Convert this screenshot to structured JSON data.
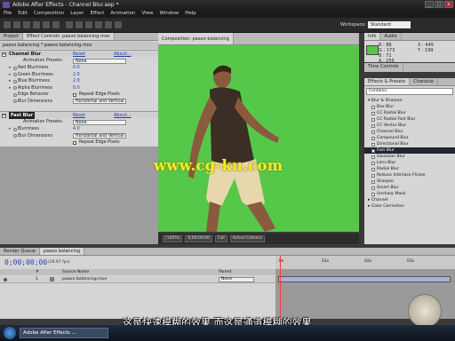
{
  "window": {
    "title": "Adobe After Effects - Channel Blur.aep *",
    "buttons": [
      "_",
      "□",
      "x"
    ]
  },
  "menu": [
    "File",
    "Edit",
    "Composition",
    "Layer",
    "Effect",
    "Animation",
    "View",
    "Window",
    "Help"
  ],
  "workspace": {
    "label": "Workspace:",
    "value": "Standard"
  },
  "left_panel": {
    "tabs": [
      "Project",
      "Effect Controls: paavo balancing.mov"
    ],
    "breadcrumb": "paavo balancing * paavo balancing.mov",
    "channel_blur": {
      "name": "Channel Blur",
      "reset": "Reset",
      "about": "About...",
      "presets_label": "Animation Presets:",
      "presets_value": "None",
      "rows": [
        {
          "label": "Red Blurriness",
          "value": "0.0"
        },
        {
          "label": "Green Blurriness",
          "value": "2.0"
        },
        {
          "label": "Blue Blurriness",
          "value": "2.0"
        },
        {
          "label": "Alpha Blurriness",
          "value": "0.0"
        }
      ],
      "edge_label": "Edge Behavior",
      "edge_value": "Repeat Edge Pixels",
      "dim_label": "Blur Dimensions",
      "dim_value": "Horizontal and Vertical"
    },
    "fast_blur": {
      "name": "Fast Blur",
      "reset": "Reset",
      "about": "About...",
      "presets_label": "Animation Presets:",
      "presets_value": "None",
      "blurriness_label": "Blurriness",
      "blurriness_value": "4.0",
      "dim_label": "Blur Dimensions",
      "dim_value": "Horizontal and Vertical",
      "repeat_label": "Repeat Edge Pixels"
    }
  },
  "comp": {
    "tab": "Composition: paavo balancing",
    "watermark": "www.cg-ku.com",
    "zoom": "(100%)",
    "time": "0;00;00;00",
    "quality": "Full",
    "camera": "Active Camera"
  },
  "info": {
    "tabs": [
      "Info",
      "Audio"
    ],
    "r": "R : 86",
    "g": "G : 173",
    "b": "B : 71",
    "a": "A : 255",
    "x": "X : 449",
    "y": "Y : 199",
    "swatch": "#5cc44b"
  },
  "time_controls": {
    "tab": "Time Controls"
  },
  "effects_presets": {
    "tabs": [
      "Effects & Presets",
      "Characte"
    ],
    "search": "Contains:",
    "category": "Blur & Sharpen",
    "items": [
      "Box Blur",
      "CC Radial Blur",
      "CC Radial Fast Blur",
      "CC Vector Blur",
      "Channel Blur",
      "Compound Blur",
      "Directional Blur",
      "Fast Blur",
      "Gaussian Blur",
      "Lens Blur",
      "Radial Blur",
      "Reduce Interlace Flicker",
      "Sharpen",
      "Smart Blur",
      "Unsharp Mask"
    ],
    "selected": "Fast Blur",
    "more": [
      "Channel",
      "Color Correction"
    ]
  },
  "timeline": {
    "tabs": [
      "Render Queue",
      "paavo balancing"
    ],
    "time": "0;00;00;00",
    "fps": "(29.97 fps)",
    "col_num": "#",
    "col_name": "Source Name",
    "col_parent": "Parent",
    "layer_num": "1",
    "layer_name": "paavo balancing.mov",
    "layer_parent": "None",
    "ruler": [
      "0s",
      "01s",
      "02s",
      "03s"
    ]
  },
  "taskbar": {
    "item": "Adobe After Effects ..."
  },
  "subtitle": "这是快速模糊的效果 而这是通道模糊的效果"
}
